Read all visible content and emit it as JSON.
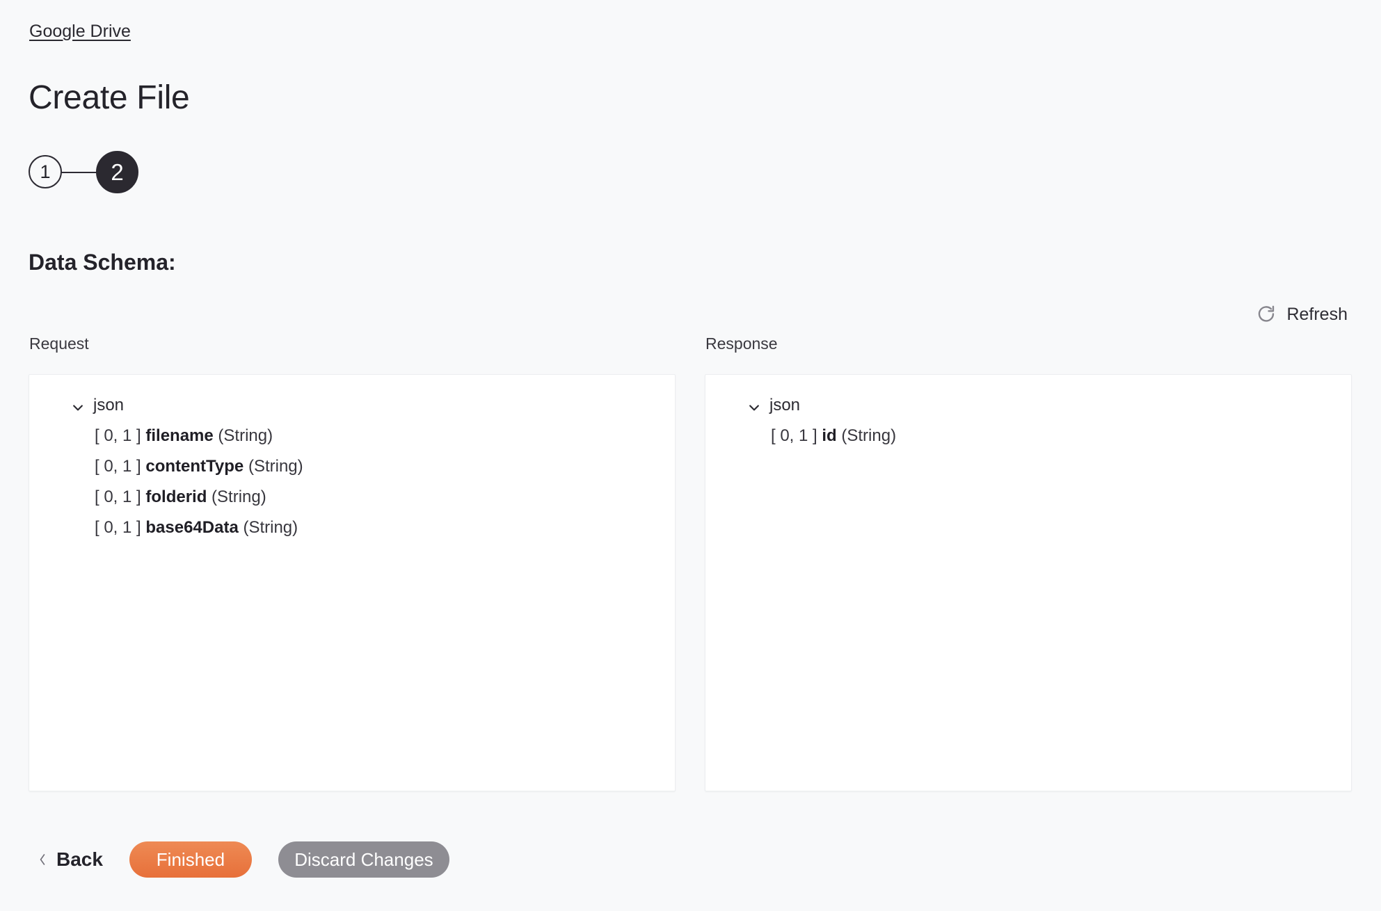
{
  "breadcrumb": {
    "label": "Google Drive"
  },
  "header": {
    "title": "Create File"
  },
  "stepper": {
    "steps": [
      {
        "label": "1",
        "state": "inactive"
      },
      {
        "label": "2",
        "state": "active"
      }
    ]
  },
  "section": {
    "heading": "Data Schema:"
  },
  "refresh": {
    "label": "Refresh",
    "icon": "refresh-icon"
  },
  "schema": {
    "request": {
      "label": "Request",
      "root": {
        "label": "json",
        "expanded": true,
        "icon": "chevron-down-icon"
      },
      "fields": [
        {
          "cardinality": "[ 0, 1 ]",
          "name": "filename",
          "type": "(String)"
        },
        {
          "cardinality": "[ 0, 1 ]",
          "name": "contentType",
          "type": "(String)"
        },
        {
          "cardinality": "[ 0, 1 ]",
          "name": "folderid",
          "type": "(String)"
        },
        {
          "cardinality": "[ 0, 1 ]",
          "name": "base64Data",
          "type": "(String)"
        }
      ]
    },
    "response": {
      "label": "Response",
      "root": {
        "label": "json",
        "expanded": true,
        "icon": "chevron-down-icon"
      },
      "fields": [
        {
          "cardinality": "[ 0, 1 ]",
          "name": "id",
          "type": "(String)"
        }
      ]
    }
  },
  "footer": {
    "back_label": "Back",
    "back_icon": "chevron-left-icon",
    "finished_label": "Finished",
    "discard_label": "Discard Changes"
  },
  "colors": {
    "page_background": "#f8f9fa",
    "panel_background": "#ffffff",
    "step_active": "#2b2930",
    "primary_action": "#e7703a",
    "secondary_action": "#8e8d93",
    "text": "#24232a"
  }
}
